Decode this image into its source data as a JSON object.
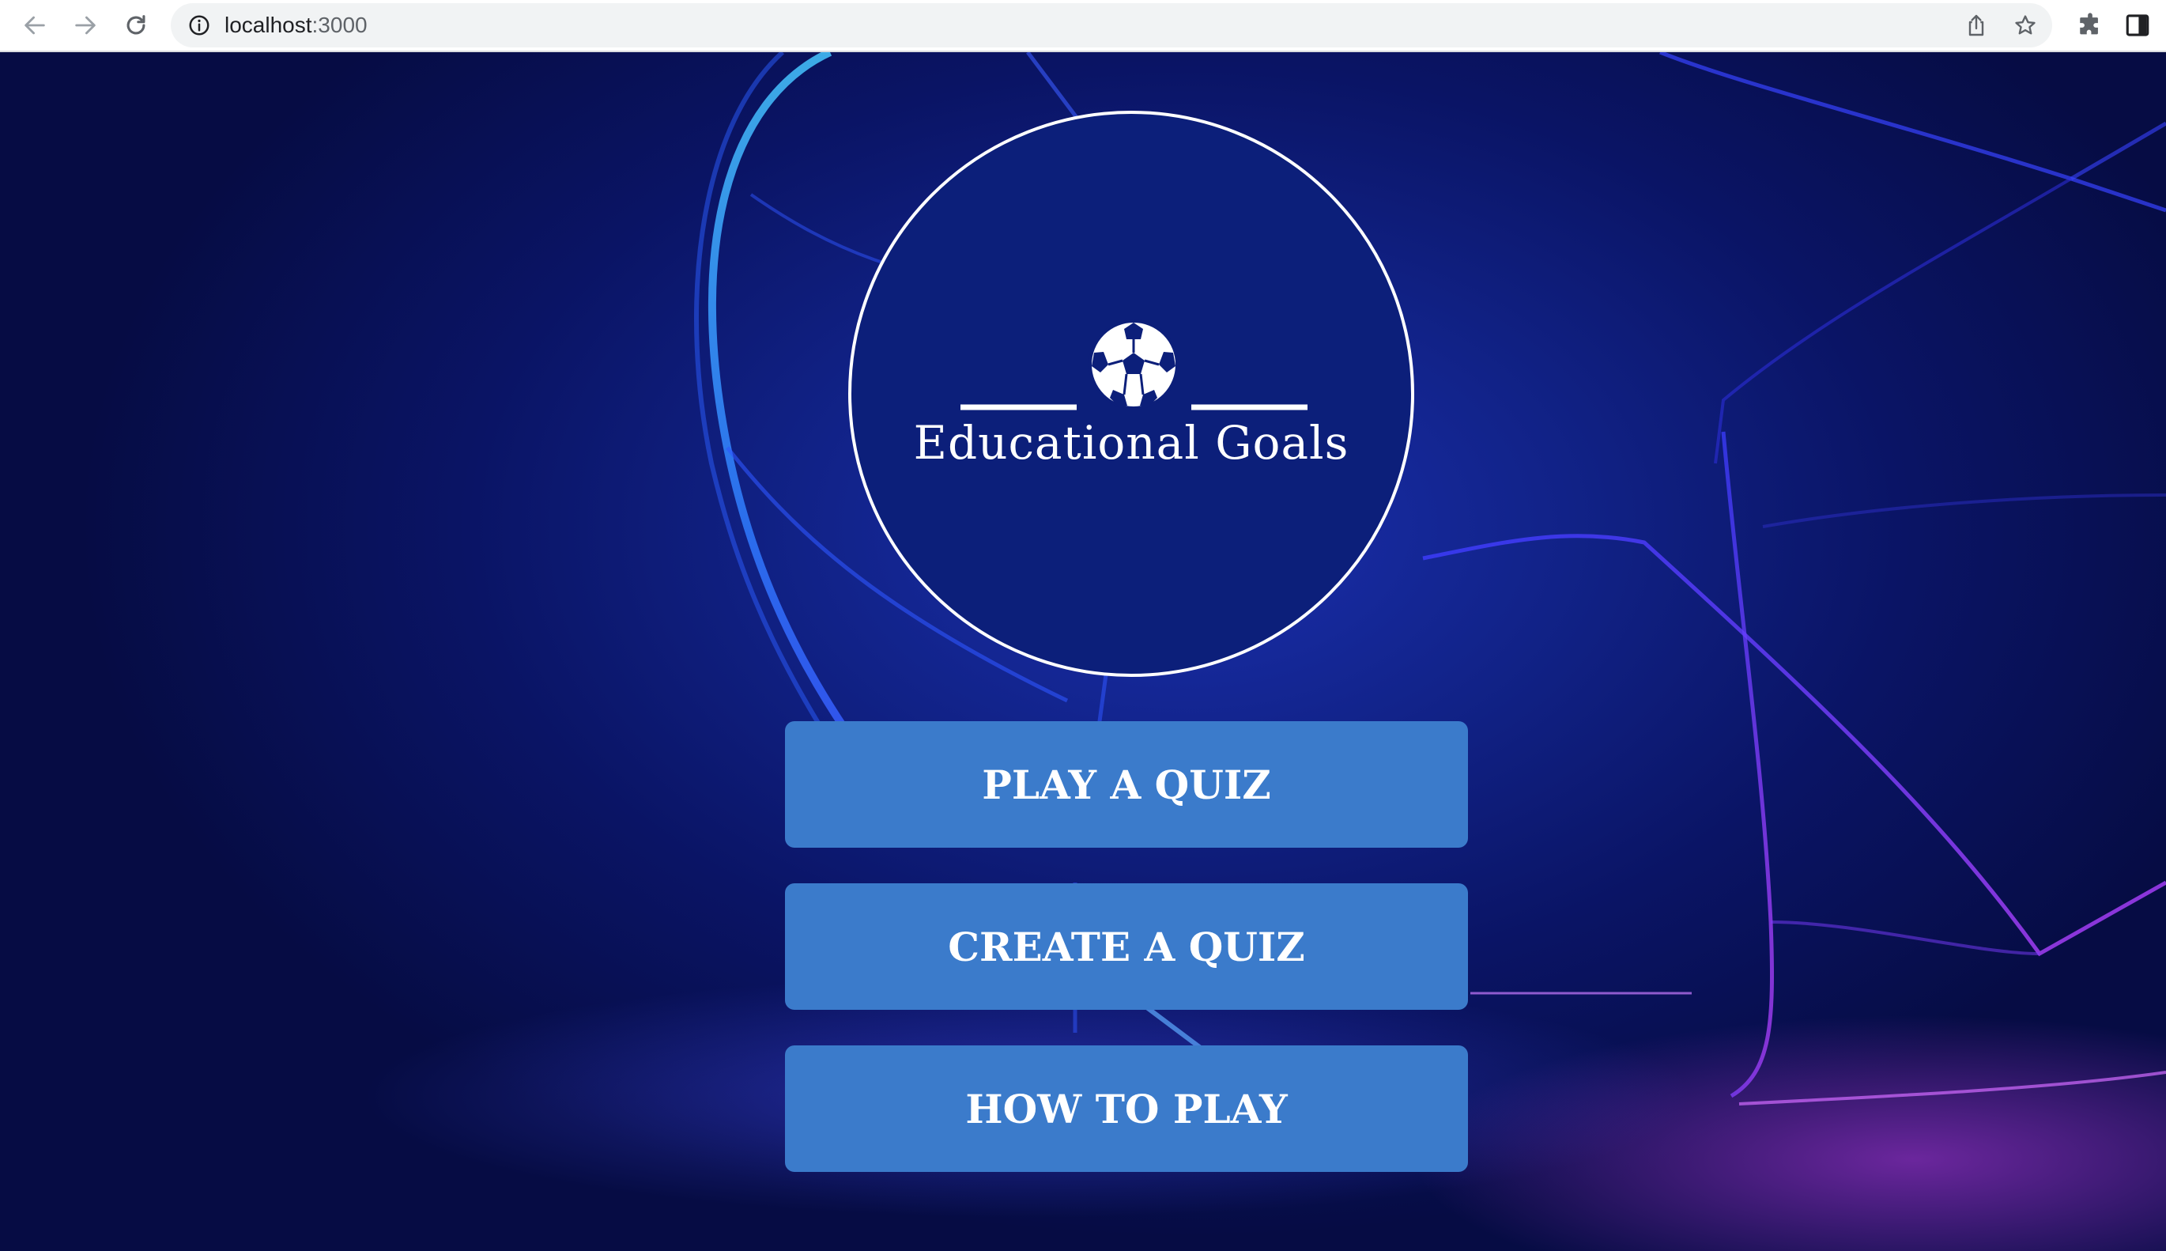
{
  "browser": {
    "url_host": "localhost",
    "url_port": ":3000",
    "icons": {
      "back": "arrow-left-icon",
      "forward": "arrow-right-icon",
      "reload": "reload-icon",
      "info": "info-icon",
      "share": "share-icon",
      "bookmark": "star-icon",
      "extensions": "puzzle-icon",
      "side_panel": "side-panel-icon"
    }
  },
  "logo": {
    "title": "Educational Goals",
    "icon": "soccer-ball-icon"
  },
  "menu": {
    "buttons": [
      {
        "label": "PLAY A QUIZ"
      },
      {
        "label": "CREATE A QUIZ"
      },
      {
        "label": "HOW TO PLAY"
      }
    ]
  },
  "colors": {
    "button_bg": "#3b7bcb",
    "logo_bg": "#0c1f7a",
    "page_bg": "#0a1465",
    "accent_purple": "#be3ce6"
  }
}
